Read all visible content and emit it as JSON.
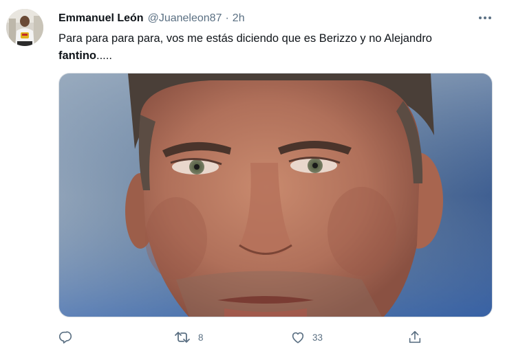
{
  "tweet": {
    "author": {
      "name": "Emmanuel León",
      "handle": "@Juaneleon87",
      "separator": "·",
      "time": "2h"
    },
    "text_main": "Para para para para, vos me estás diciendo que es Berizzo y no Alejandro",
    "text_bold": "fantino",
    "text_tail": ".....",
    "media": {
      "alt": "Close-up of a man's face"
    },
    "actions": {
      "reply": {
        "icon": "reply-icon"
      },
      "retweet": {
        "icon": "retweet-icon",
        "count": "8"
      },
      "like": {
        "icon": "heart-icon",
        "count": "33"
      },
      "share": {
        "icon": "share-icon"
      }
    }
  },
  "colors": {
    "text": "#0f1419",
    "secondary": "#5b7083"
  }
}
